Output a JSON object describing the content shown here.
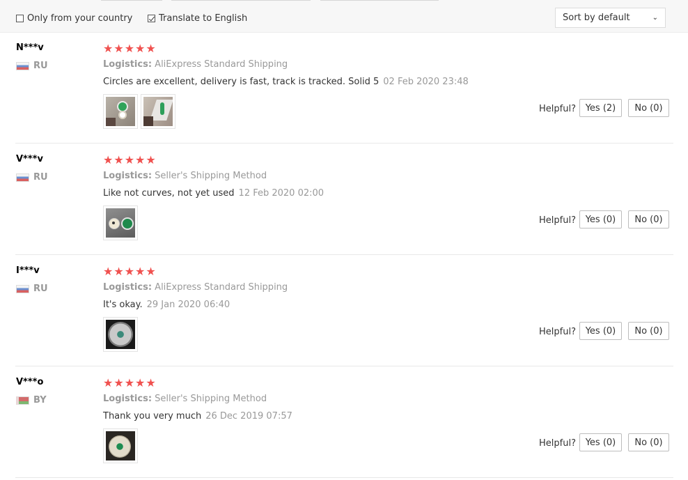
{
  "filters": {
    "only_country": {
      "label": "Only from your country",
      "checked": false
    },
    "translate": {
      "label": "Translate to English",
      "checked": true
    },
    "sort": {
      "selected": "Sort by default"
    }
  },
  "helpful_label": "Helpful?",
  "reviews": [
    {
      "user": "N***v",
      "country": "RU",
      "stars": "★★★★★",
      "logistics_label": "Logistics:",
      "logistics": "AliExpress Standard Shipping",
      "comment": "Circles are excellent, delivery is fast, track is tracked. Solid 5",
      "date": "02 Feb 2020 23:48",
      "yes": "Yes (2)",
      "no": "No (0)"
    },
    {
      "user": "V***v",
      "country": "RU",
      "stars": "★★★★★",
      "logistics_label": "Logistics:",
      "logistics": "Seller's Shipping Method",
      "comment": "Like not curves, not yet used",
      "date": "12 Feb 2020 02:00",
      "yes": "Yes (0)",
      "no": "No (0)"
    },
    {
      "user": "I***v",
      "country": "RU",
      "stars": "★★★★★",
      "logistics_label": "Logistics:",
      "logistics": "AliExpress Standard Shipping",
      "comment": "It's okay.",
      "date": "29 Jan 2020 06:40",
      "yes": "Yes (0)",
      "no": "No (0)"
    },
    {
      "user": "V***o",
      "country": "BY",
      "stars": "★★★★★",
      "logistics_label": "Logistics:",
      "logistics": "Seller's Shipping Method",
      "comment": "Thank you very much",
      "date": "26 Dec 2019 07:57",
      "yes": "Yes (0)",
      "no": "No (0)"
    }
  ]
}
